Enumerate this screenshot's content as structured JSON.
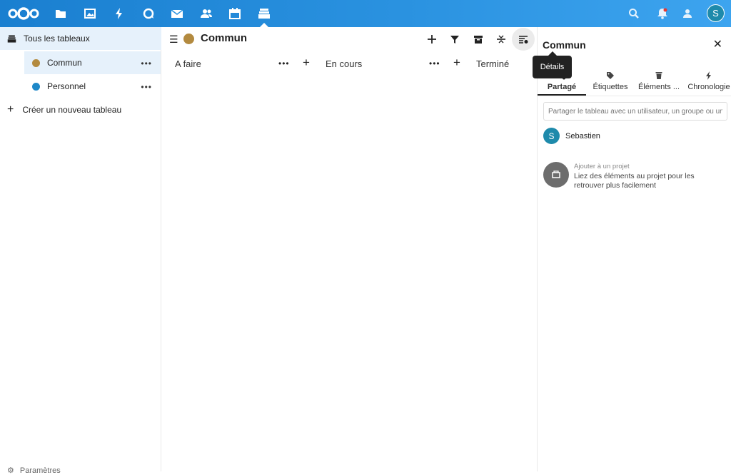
{
  "topbar": {
    "apps": [
      "files-icon",
      "photos-icon",
      "activity-icon",
      "talk-icon",
      "mail-icon",
      "contacts-icon",
      "calendar-icon",
      "deck-icon"
    ],
    "user_initial": "S",
    "brand_color": "#1a7fd0"
  },
  "sidebar": {
    "all_boards": "Tous les tableaux",
    "boards": [
      {
        "label": "Commun",
        "color": "#b38a3f"
      },
      {
        "label": "Personnel",
        "color": "#1e88c8"
      }
    ],
    "create": "Créer un nouveau tableau",
    "settings": "Paramètres"
  },
  "board": {
    "title": "Commun",
    "color": "#b38a3f",
    "stacks": [
      "A faire",
      "En cours",
      "Terminé"
    ]
  },
  "tooltip": {
    "label": "Détails"
  },
  "details": {
    "title": "Commun",
    "tabs": [
      "Partagé",
      "Étiquettes",
      "Éléments ...",
      "Chronologie"
    ],
    "share_placeholder": "Partager le tableau avec un utilisateur, un groupe ou un",
    "user": {
      "initial": "S",
      "name": "Sebastien"
    },
    "project": {
      "label": "Ajouter à un projet",
      "text": "Liez des éléments au projet pour les retrouver plus facilement"
    }
  }
}
